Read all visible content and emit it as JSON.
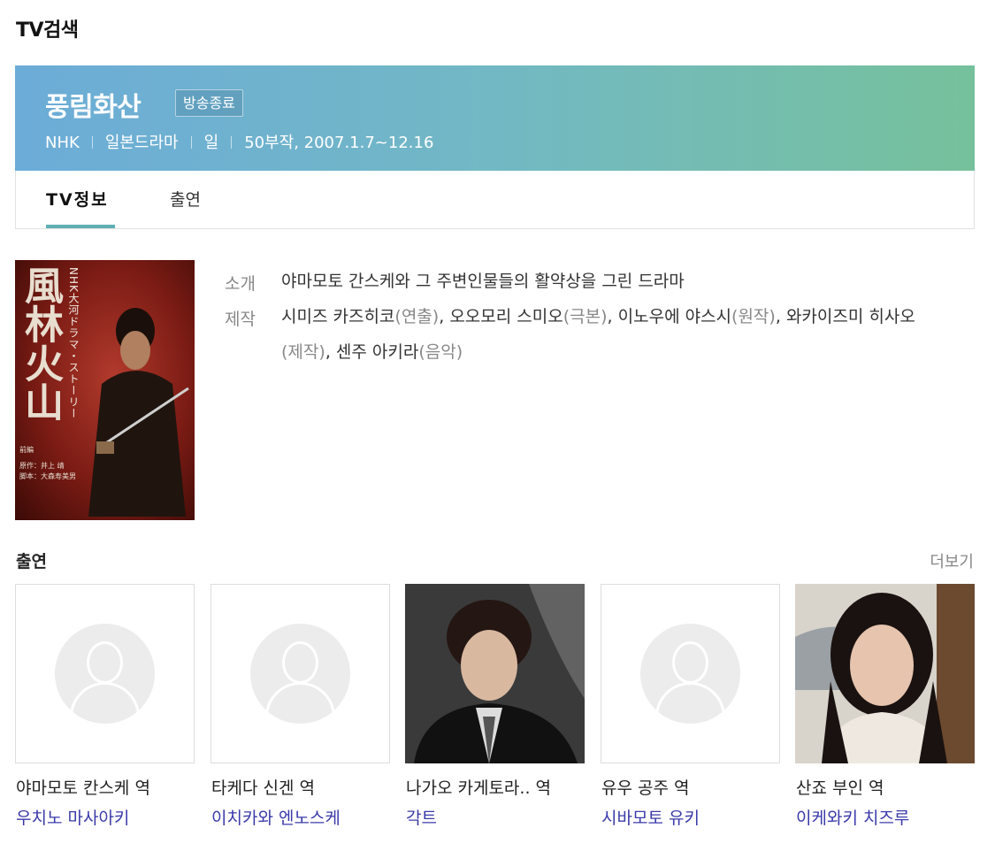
{
  "section_title": "TV검색",
  "program": {
    "title": "풍림화산",
    "status_badge": "방송종료",
    "meta": [
      "NHK",
      "일본드라마",
      "일",
      "50부작, 2007.1.7~12.16"
    ]
  },
  "tabs": [
    {
      "label": "TV정보",
      "active": true
    },
    {
      "label": "출연",
      "active": false
    }
  ],
  "poster": {
    "calligraphy": "風林火山",
    "vertical_text": "NHK大河ドラマ・ストーリー",
    "volume": "前編",
    "credits": [
      "原作：井上 靖",
      "脚本：大森寿美男"
    ]
  },
  "info": {
    "intro_label": "소개",
    "intro_text": "야마모토 간스케와 그 주변인물들의 활약상을 그린 드라마",
    "production_label": "제작",
    "production": [
      {
        "name": "시미즈 카즈히코",
        "role": "연출"
      },
      {
        "name": "오오모리 스미오",
        "role": "극본"
      },
      {
        "name": "이노우에 야스시",
        "role": "원작"
      },
      {
        "name": "와카이즈미 히사오",
        "role": "제작"
      },
      {
        "name": "센주 아키라",
        "role": "음악"
      }
    ]
  },
  "cast": {
    "heading": "출연",
    "more_label": "더보기",
    "members": [
      {
        "role": "야마모토 칸스케 역",
        "actor": "우치노 마사아키",
        "photo": "placeholder"
      },
      {
        "role": "타케다 신겐 역",
        "actor": "이치카와 엔노스케",
        "photo": "placeholder"
      },
      {
        "role": "나가오 카게토라.. 역",
        "actor": "각트",
        "photo": "man"
      },
      {
        "role": "유우 공주 역",
        "actor": "시바모토 유키",
        "photo": "placeholder"
      },
      {
        "role": "산죠 부인 역",
        "actor": "이케와키 치즈루",
        "photo": "woman"
      }
    ]
  },
  "colors": {
    "banner_start": "#6cacd8",
    "banner_end": "#76c19c",
    "tab_accent": "#5fb0b5",
    "actor_link": "#3a3aaa"
  }
}
